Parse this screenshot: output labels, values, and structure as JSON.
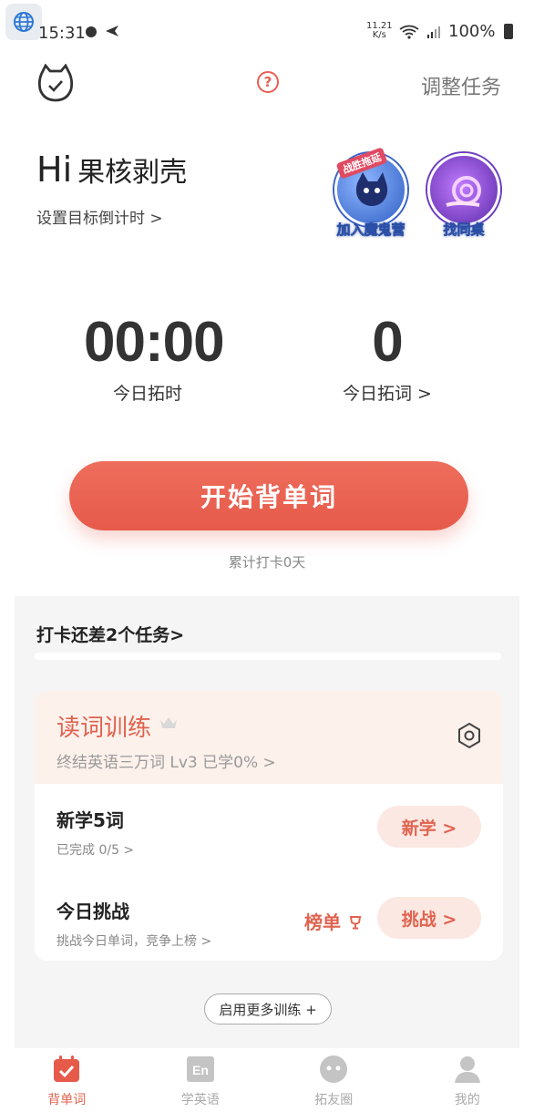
{
  "status_bar": {
    "time": "15:31",
    "net_speed_value": "11.21",
    "net_speed_unit": "K/s",
    "battery": "100%"
  },
  "top_bar": {
    "adjust_task": "调整任务",
    "help": "?"
  },
  "greeting": {
    "hi": "Hi",
    "name": "果核剥壳",
    "countdown_link": "设置目标倒计时 >"
  },
  "badges": {
    "join_label": "加入魔鬼营",
    "join_ribbon": "战胜拖延",
    "deskmate_label": "找同桌"
  },
  "stats": {
    "time_value": "00:00",
    "time_label": "今日拓时",
    "words_value": "0",
    "words_label": "今日拓词 >"
  },
  "start_button": "开始背单词",
  "checkin_days": "累计打卡0天",
  "tasks": {
    "header": "打卡还差2个任务>",
    "training": {
      "title": "读词训练",
      "subtitle": "终结英语三万词 Lv3  已学0% >"
    },
    "new_words": {
      "title": "新学5词",
      "sub": "已完成 0/5 >",
      "button": "新学 >"
    },
    "challenge": {
      "title": "今日挑战",
      "sub": "挑战今日单词，竞争上榜 >",
      "rank": "榜单",
      "button": "挑战 >"
    },
    "more_training": "启用更多训练 +"
  },
  "bottom_nav": {
    "items": [
      {
        "label": "背单词",
        "icon": "calendar-check-icon",
        "active": true
      },
      {
        "label": "学英语",
        "icon": "en-icon",
        "active": false
      },
      {
        "label": "拓友圈",
        "icon": "chat-bubble-icon",
        "active": false
      },
      {
        "label": "我的",
        "icon": "person-icon",
        "active": false
      }
    ]
  },
  "colors": {
    "accent": "#e65a4a",
    "accent_light": "#fce8e3",
    "card_tint": "#fdf1ec"
  }
}
